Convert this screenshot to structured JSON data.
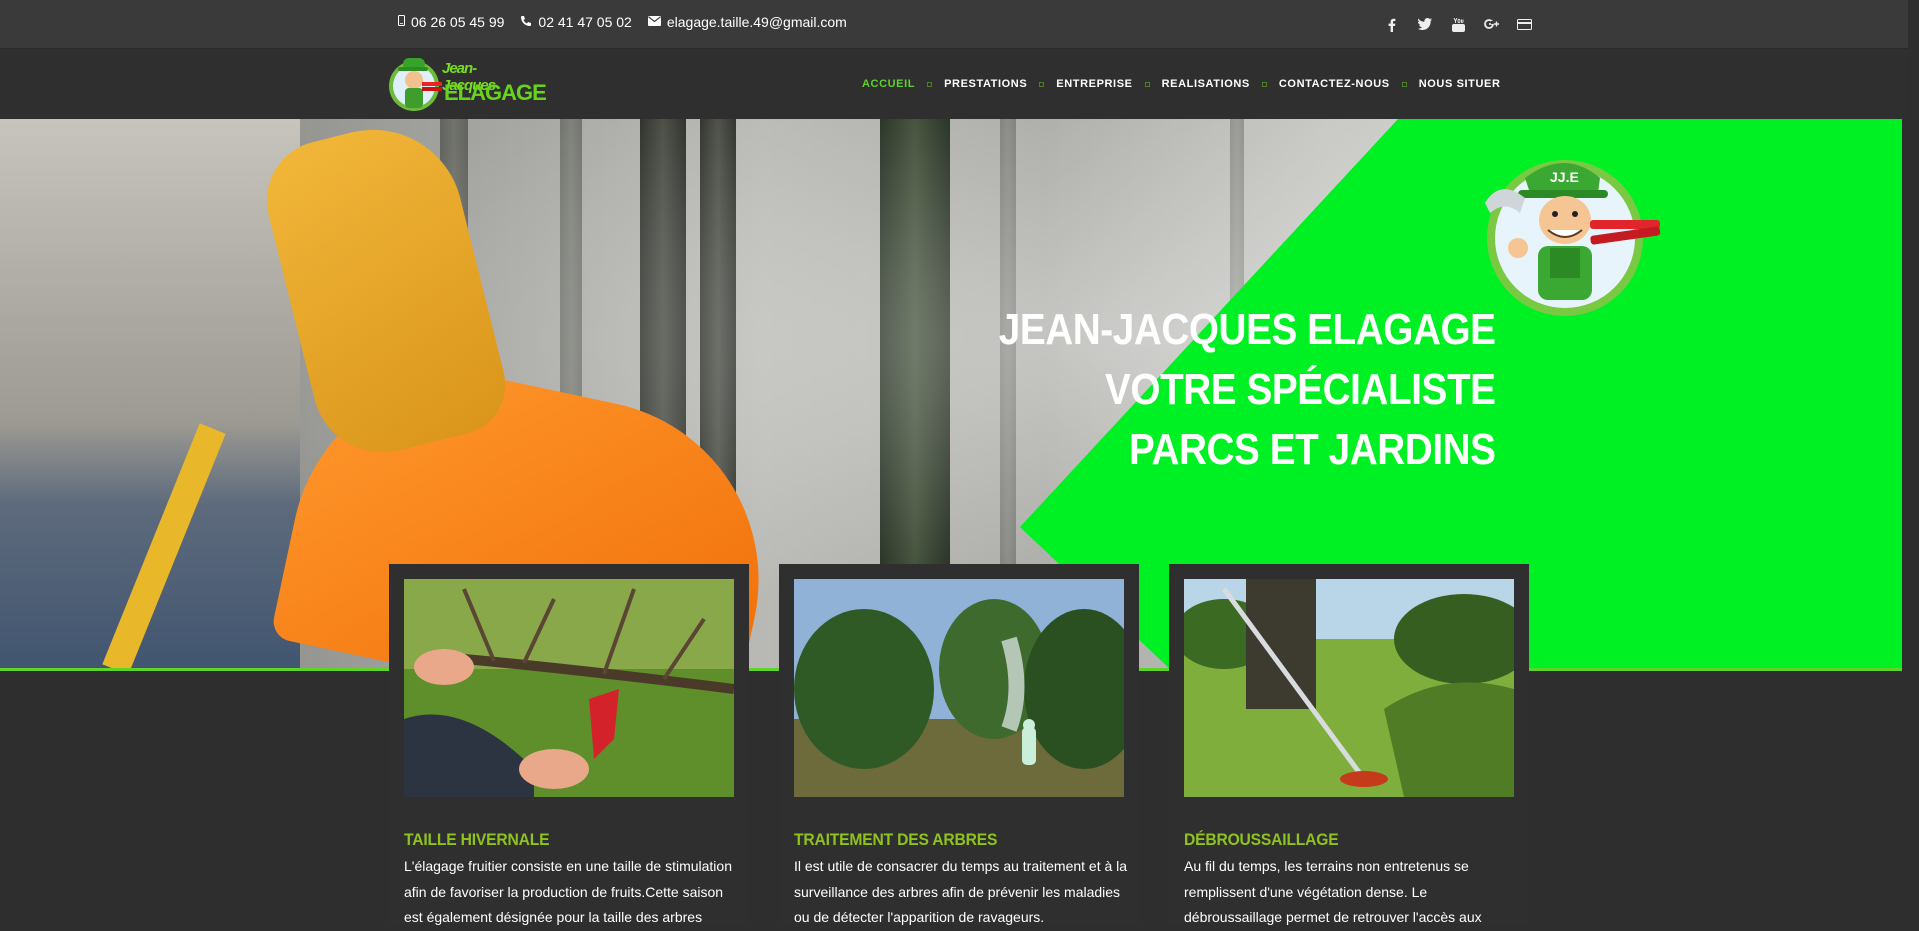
{
  "topbar": {
    "phone_mobile": "06 26 05 45 99",
    "phone_fixed": "02 41 47 05 02",
    "email": "elagage.taille.49@gmail.com",
    "social": [
      "facebook-icon",
      "twitter-icon",
      "youtube-icon",
      "google-plus-icon",
      "payment-card-icon"
    ]
  },
  "logo": {
    "line1": "Jean-Jacques",
    "line2": "ELAGAGE"
  },
  "nav": {
    "items": [
      {
        "label": "ACCUEIL",
        "active": true
      },
      {
        "label": "PRESTATIONS",
        "active": false
      },
      {
        "label": "ENTREPRISE",
        "active": false
      },
      {
        "label": "REALISATIONS",
        "active": false
      },
      {
        "label": "CONTACTEZ-NOUS",
        "active": false
      },
      {
        "label": "NOUS SITUER",
        "active": false
      }
    ]
  },
  "hero": {
    "line1": "JEAN-JACQUES ELAGAGE",
    "line2": "VOTRE SPÉCIALISTE",
    "line3": "PARCS ET JARDINS",
    "mascot_badge": "JJ.E"
  },
  "cards": [
    {
      "title": "TAILLE HIVERNALE",
      "text": "L'élagage fruitier consiste en une taille de stimulation afin de favoriser la production de fruits.Cette saison est également désignée pour la taille des arbres"
    },
    {
      "title": "TRAITEMENT DES ARBRES",
      "text": "Il est utile de consacrer du temps au traitement et à la surveillance des arbres afin de prévenir les maladies ou de détecter l'apparition de ravageurs."
    },
    {
      "title": "DÉBROUSSAILLAGE",
      "text": "Au fil du temps, les terrains non entretenus se remplissent d'une végétation dense. Le débroussaillage permet de retrouver l'accès aux"
    }
  ],
  "colors": {
    "accent": "#5fd32a",
    "hero_green": "#00f123",
    "card_title": "#8ec31e",
    "bg": "#2e2e2e"
  }
}
